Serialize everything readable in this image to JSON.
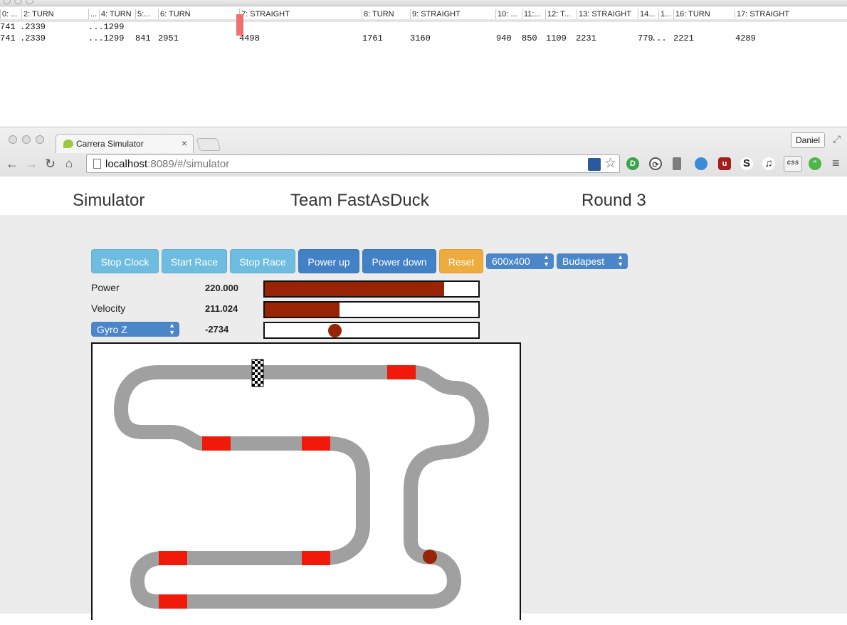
{
  "strip": {
    "segments": [
      {
        "label": "0: ...",
        "col": 0
      },
      {
        "label": "2: TURN",
        "col": 1
      },
      {
        "label": "...",
        "col": 2
      },
      {
        "label": "4: TURN",
        "col": 3
      },
      {
        "label": "5:...",
        "col": 4
      },
      {
        "label": "6: TURN",
        "col": 5
      },
      {
        "label": "7: STRAIGHT",
        "col": 6
      },
      {
        "label": "8: TURN",
        "col": 7
      },
      {
        "label": "9: STRAIGHT",
        "col": 8
      },
      {
        "label": "10: ...",
        "col": 9
      },
      {
        "label": "11:...",
        "col": 10
      },
      {
        "label": "12: T...",
        "col": 11
      },
      {
        "label": "13: STRAIGHT",
        "col": 12
      },
      {
        "label": "14...",
        "col": 13
      },
      {
        "label": "1...",
        "col": 14
      },
      {
        "label": "16: TURN",
        "col": 15
      },
      {
        "label": "17: STRAIGHT",
        "col": 16
      }
    ],
    "row1": [
      "741",
      ".2339",
      "...1299"
    ],
    "row2": [
      "741",
      ".2339",
      "...1299",
      "841",
      "2951",
      "4498",
      "1761",
      "3160",
      "940",
      "850",
      "1109",
      "2231",
      "779",
      "...",
      "2221",
      "4289"
    ]
  },
  "browser": {
    "tab_title": "Carrera Simulator",
    "tab_close": "×",
    "profile_name": "Daniel",
    "url_host": "localhost",
    "url_rest": ":8089/#/simulator",
    "icons": [
      "back-icon",
      "forward-icon",
      "reload-icon",
      "home-icon",
      "page-icon",
      "bookmark-star-icon"
    ]
  },
  "header": {
    "left": "Simulator",
    "center": "Team FastAsDuck",
    "right": "Round 3"
  },
  "toolbar": {
    "stop_clock": "Stop Clock",
    "start_race": "Start Race",
    "stop_race": "Stop Race",
    "power_up": "Power up",
    "power_down": "Power down",
    "reset": "Reset",
    "resolution": "600x400",
    "track": "Budapest"
  },
  "telemetry": {
    "power_label": "Power",
    "power_value": "220.000",
    "power_fraction": 0.84,
    "velocity_label": "Velocity",
    "velocity_value": "211.024",
    "velocity_fraction": 0.35,
    "sensor_select": "Gyro Z",
    "sensor_value": "-2734",
    "sensor_fraction": 0.33
  },
  "colors": {
    "accent_info": "#6ebde0",
    "accent_primary": "#4281c6",
    "accent_warn": "#efac3e",
    "bar_fill": "#992305",
    "track_grey": "#a0a0a0",
    "track_red": "#f0190a"
  }
}
